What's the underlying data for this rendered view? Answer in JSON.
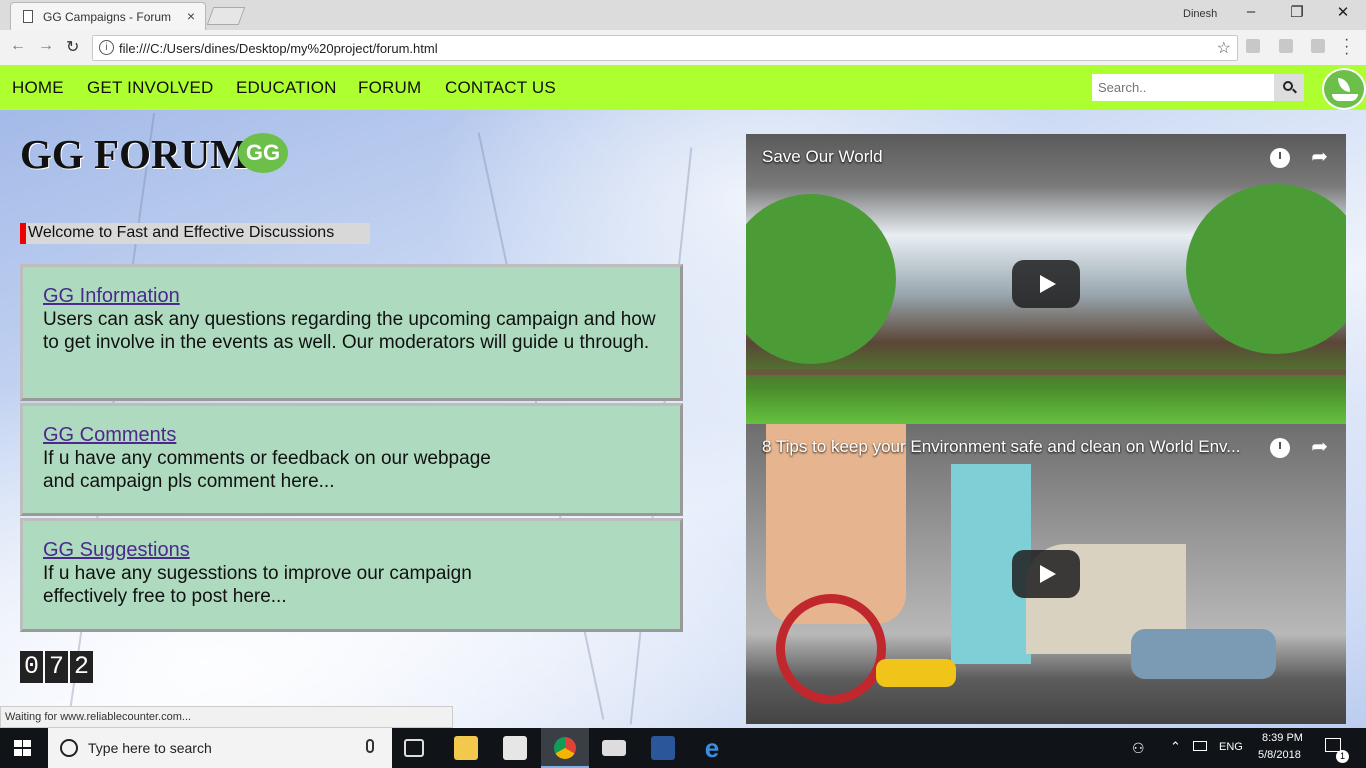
{
  "browser": {
    "tab_title": "GG Campaigns - Forum",
    "tab_close": "×",
    "window_user": "Dinesh",
    "minimize": "–",
    "restore": "❐",
    "close": "✕",
    "back": "←",
    "forward": "→",
    "reload": "↻",
    "url": "file:///C:/Users/dines/Desktop/my%20project/forum.html",
    "info": "i",
    "star": "☆"
  },
  "navbar": {
    "items": [
      "HOME",
      "GET INVOLVED",
      "EDUCATION",
      "FORUM",
      "CONTACT US"
    ],
    "search_placeholder": "Search..",
    "accent_color": "#adff2f"
  },
  "page": {
    "heading": "GG FORUM",
    "badge": "GG",
    "welcome": "Welcome to Fast and Effective Discussions",
    "cards": [
      {
        "title": "GG Information",
        "text": "Users can ask any questions regarding the upcoming campaign and how to get involve in the events as well. Our moderators will guide u through."
      },
      {
        "title": "GG Comments",
        "text": "If u have any comments or feedback on our webpage and campaign pls comment here..."
      },
      {
        "title": "GG Suggestions",
        "text": "If u have any sugesstions to improve our campaign effectively free to post here..."
      }
    ],
    "counter_digits": [
      "0",
      "7",
      "2"
    ]
  },
  "videos": [
    {
      "title": "Save Our World"
    },
    {
      "title": "8 Tips to keep your Environment safe and clean on World Env..."
    }
  ],
  "status_bar": "Waiting for www.reliablecounter.com...",
  "taskbar": {
    "search_placeholder": "Type here to search",
    "language": "ENG",
    "time": "8:39 PM",
    "date": "5/8/2018",
    "notifications": "1"
  }
}
